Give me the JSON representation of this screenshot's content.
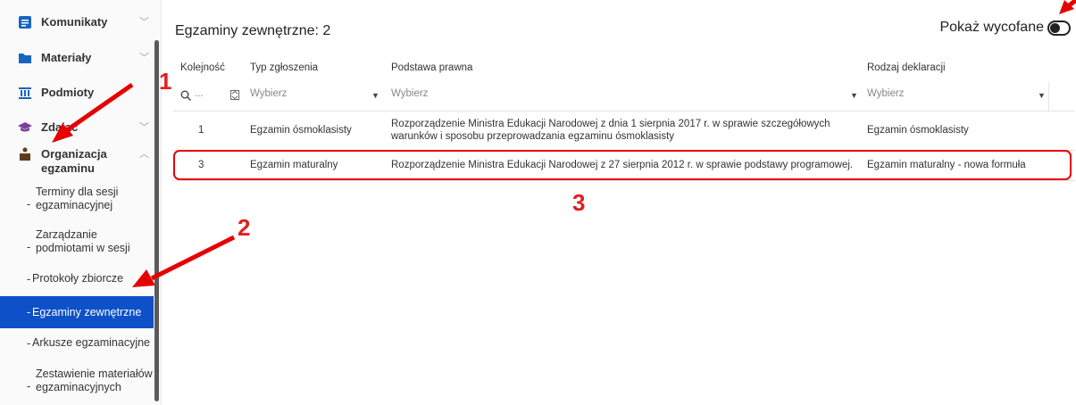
{
  "sidebar": {
    "items": [
      {
        "label": "Komunikaty"
      },
      {
        "label": "Materiały"
      },
      {
        "label": "Podmioty"
      },
      {
        "label": "Zdając"
      },
      {
        "label": "Organizacja egzaminu"
      }
    ],
    "sub_items": [
      {
        "label": "Terminy dla sesji egzaminacyjnej"
      },
      {
        "label": "Zarządzanie podmiotami w sesji"
      },
      {
        "label": "Protokoły zbiorcze"
      },
      {
        "label": "Egzaminy zewnętrzne"
      },
      {
        "label": "Arkusze egzaminacyjne"
      },
      {
        "label": "Zestawienie materiałów egzaminacyjnych"
      }
    ],
    "dash": "-"
  },
  "main": {
    "title": "Egzaminy zewnętrzne: 2",
    "toggle_label": "Pokaż wycofane",
    "columns": [
      "Kolejność",
      "Typ zgłoszenia",
      "Podstawa prawna",
      "Rodzaj deklaracji"
    ],
    "filters": {
      "search_placeholder": "...",
      "typ": "Wybierz",
      "podstawa": "Wybierz",
      "rodzaj": "Wybierz"
    },
    "rows": [
      {
        "kolejnosc": "1",
        "typ": "Egzamin ósmoklasisty",
        "podstawa": "Rozporządzenie Ministra Edukacji Narodowej z dnia 1 sierpnia 2017 r. w sprawie szczegółowych warunków i sposobu przeprowadzania egzaminu ósmoklasisty",
        "rodzaj": "Egzamin ósmoklasisty"
      },
      {
        "kolejnosc": "3",
        "typ": "Egzamin maturalny",
        "podstawa": "Rozporządzenie Ministra Edukacji Narodowej z 27 sierpnia 2012 r. w sprawie podstawy programowej.",
        "rodzaj": "Egzamin maturalny - nowa formuła"
      }
    ]
  },
  "annotations": {
    "n1": "1",
    "n2": "2",
    "n3": "3",
    "color": "#e60000"
  },
  "colors": {
    "accent": "#0d50c8",
    "icon": "#1565c0",
    "annotation": "#e60000"
  }
}
